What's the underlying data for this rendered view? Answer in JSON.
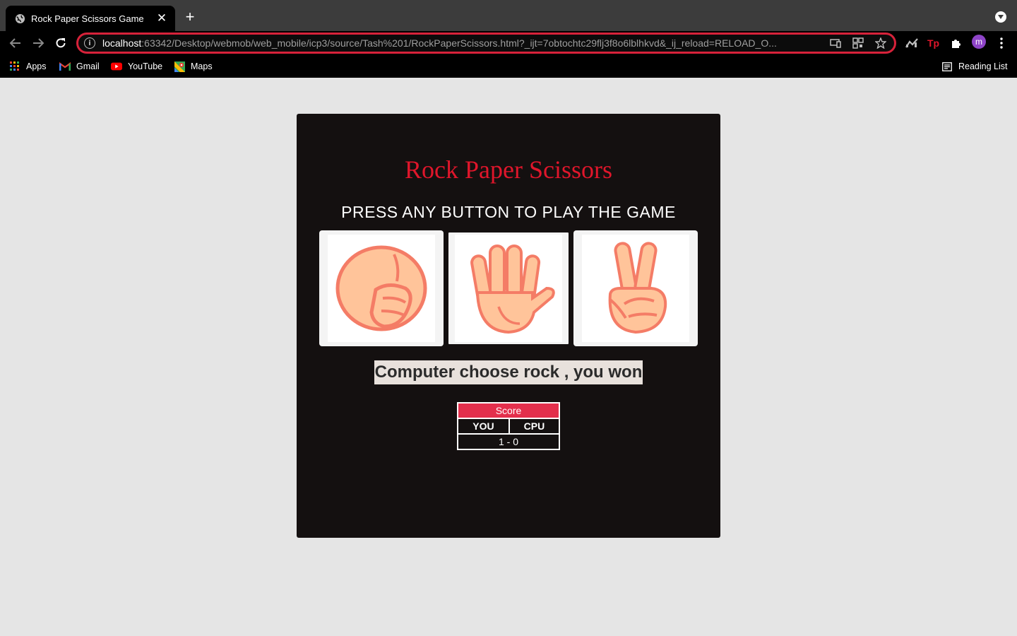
{
  "browser": {
    "tab_title": "Rock Paper Scissors Game",
    "url_host": "localhost",
    "url_rest": ":63342/Desktop/webmob/web_mobile/icp3/source/Tash%201/RockPaperScissors.html?_ijt=7obtochtc29flj3f8o6lblhkvd&_ij_reload=RELOAD_O...",
    "avatar_letter": "m",
    "bookmarks": [
      "Apps",
      "Gmail",
      "YouTube",
      "Maps"
    ],
    "reading_list": "Reading List"
  },
  "game": {
    "title": "Rock Paper Scissors",
    "prompt": "PRESS ANY BUTTON TO PLAY THE GAME",
    "choices": [
      {
        "name": "rock",
        "selected": false
      },
      {
        "name": "paper",
        "selected": true
      },
      {
        "name": "scissors",
        "selected": false
      }
    ],
    "result": "Computer choose rock , you won",
    "score": {
      "header": "Score",
      "you_label": "YOU",
      "cpu_label": "CPU",
      "value": "1 - 0"
    }
  },
  "colors": {
    "accent": "#e0162b",
    "panel": "#141010",
    "score_header": "#e32f4c",
    "skin": "#ffc49a",
    "skin_outline": "#f47c66"
  }
}
